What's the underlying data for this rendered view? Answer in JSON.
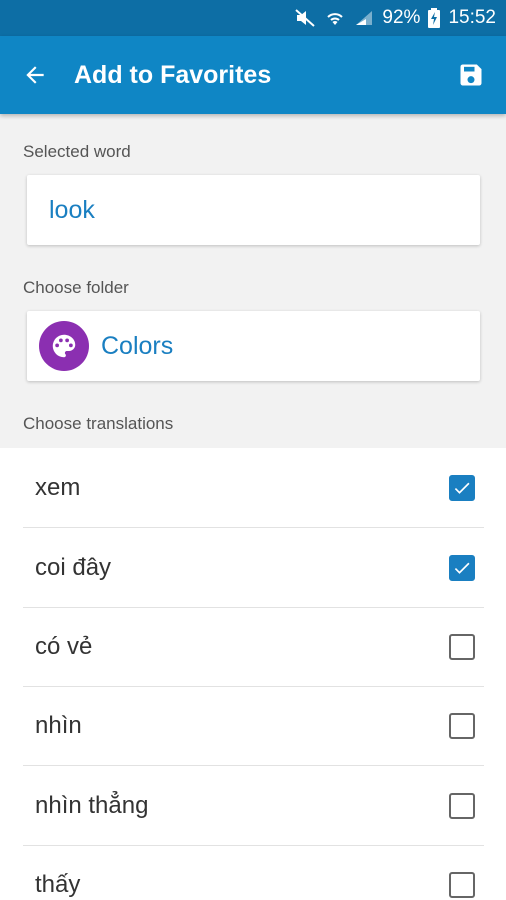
{
  "status_bar": {
    "battery": "92%",
    "time": "15:52",
    "icons": [
      "mute-icon",
      "wifi-icon",
      "signal-icon",
      "battery-charging-icon"
    ]
  },
  "app_bar": {
    "title": "Add to Favorites",
    "back_icon": "arrow-back-icon",
    "save_icon": "save-icon"
  },
  "selected_word": {
    "label": "Selected word",
    "value": "look"
  },
  "folder": {
    "label": "Choose folder",
    "name": "Colors",
    "icon": "palette-icon",
    "icon_color": "#8b2fb1"
  },
  "translations": {
    "label": "Choose translations",
    "items": [
      {
        "text": "xem",
        "checked": true
      },
      {
        "text": "coi đây",
        "checked": true
      },
      {
        "text": "có vẻ",
        "checked": false
      },
      {
        "text": "nhìn",
        "checked": false
      },
      {
        "text": "nhìn thẳng",
        "checked": false
      },
      {
        "text": "thấy",
        "checked": false
      }
    ]
  },
  "colors": {
    "status_bar": "#0d6ea5",
    "app_bar": "#0f86c5",
    "accent": "#1a7fc1"
  }
}
